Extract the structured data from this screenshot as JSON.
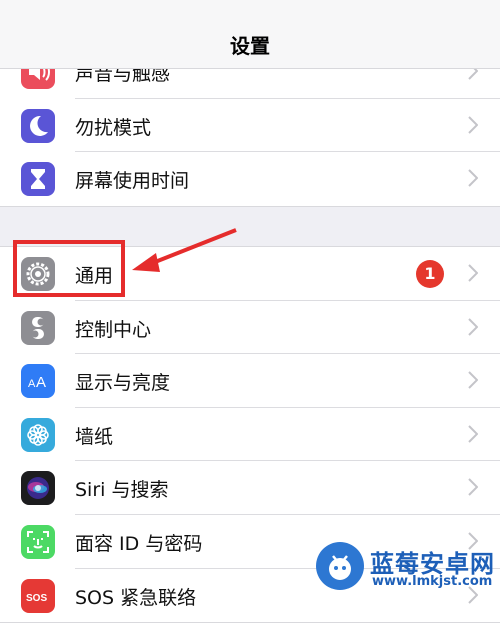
{
  "navbar": {
    "title": "设置"
  },
  "group1": [
    {
      "label": "声音与触感",
      "icon": "speaker-icon",
      "color": "#eb4d5c"
    },
    {
      "label": "勿扰模式",
      "icon": "moon-icon",
      "color": "#5a55d6"
    },
    {
      "label": "屏幕使用时间",
      "icon": "hourglass-icon",
      "color": "#5a55d6"
    }
  ],
  "group2": [
    {
      "label": "通用",
      "icon": "gear-icon",
      "color": "#8e8e93",
      "badge": "1"
    },
    {
      "label": "控制中心",
      "icon": "toggles-icon",
      "color": "#8e8e93"
    },
    {
      "label": "显示与亮度",
      "icon": "text-size-icon",
      "color": "#2f7cf6"
    },
    {
      "label": "墙纸",
      "icon": "flower-icon",
      "color": "#36aadc"
    },
    {
      "label": "Siri 与搜索",
      "icon": "siri-icon",
      "color": "#222222"
    },
    {
      "label": "面容 ID 与密码",
      "icon": "face-id-icon",
      "color": "#4cd964"
    },
    {
      "label": "SOS 紧急联络",
      "icon": "sos-icon",
      "color": "#e53935"
    }
  ],
  "annotation": {
    "highlight_color": "#e52c2c"
  },
  "watermark": {
    "title": "蓝莓安卓网",
    "url": "www.lmkjst.com"
  }
}
